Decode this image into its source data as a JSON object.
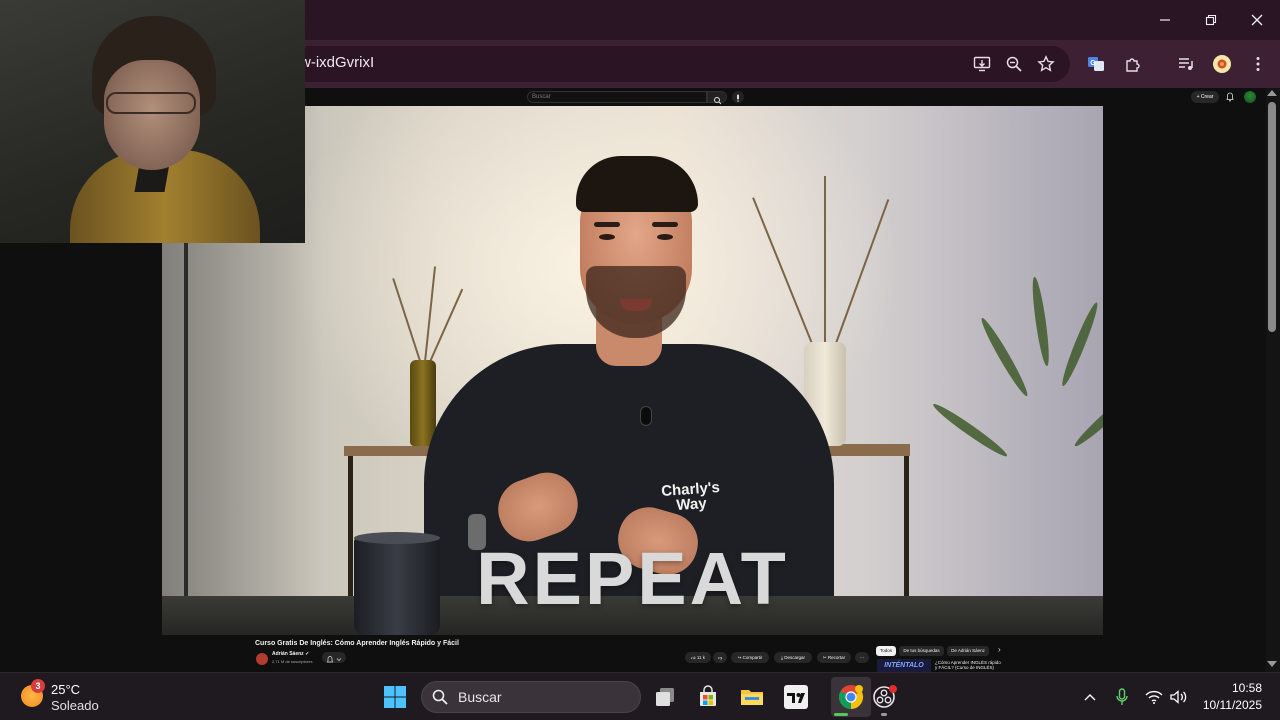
{
  "browser": {
    "url_fragment": "w-ixdGvrixI"
  },
  "youtube": {
    "search_placeholder": "Buscar",
    "create_label": "+ Crear",
    "video_caption": "REPEAT",
    "shirt_logo": "Charly's Way",
    "video_title": "Curso Gratis De Inglés: Cómo Aprender Inglés Rápido y Fácil",
    "channel_name": "Adrián Sáenz ✓",
    "channel_subs": "2,71 M de suscriptores",
    "actions": {
      "likes": "11 k",
      "share": "Compartir",
      "download": "Descargar",
      "clip": "Recortar",
      "more": "···"
    },
    "chips": [
      "Todos",
      "De tus búsquedas",
      "De Adrián Sáenz"
    ],
    "rec_thumb_text": "INTÉNTALO",
    "rec_title": "¿Cómo Aprender INGLÉS rápido y FÁCIL? (Curso de INGLÉS)"
  },
  "taskbar": {
    "weather_badge": "3",
    "temperature": "25°C",
    "condition": "Soleado",
    "search_label": "Buscar",
    "time": "10:58",
    "date": "10/11/2025"
  },
  "colors": {
    "chrome_titlebar": "#2a1525",
    "chrome_toolbar": "#3d2034",
    "youtube_bg": "#0f0f0f",
    "taskbar_bg": "#1f1a1f"
  }
}
